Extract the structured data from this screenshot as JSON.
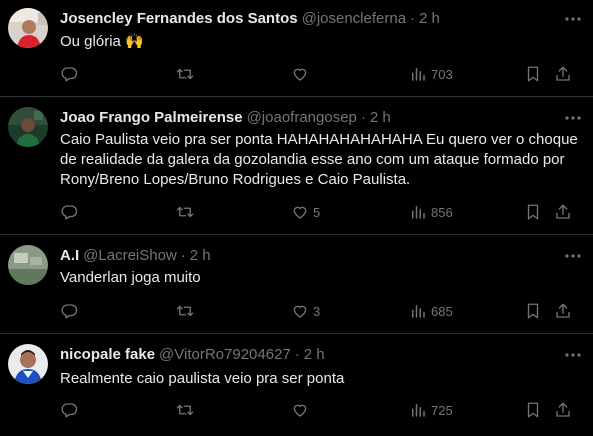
{
  "tweets": [
    {
      "display_name": "Josencley Fernandes dos Santos",
      "handle": "@josencleferna",
      "separator": "·",
      "time": "2 h",
      "text": "Ou glória 🙌",
      "replies": "",
      "retweets": "",
      "likes": "",
      "views": "703"
    },
    {
      "display_name": "Joao Frango Palmeirense",
      "handle": "@joaofrangosep",
      "separator": "·",
      "time": "2 h",
      "text": "Caio Paulista veio pra ser ponta HAHAHAHAHAHAHA Eu quero ver o choque de realidade da galera da gozolandia esse ano com um ataque formado por Rony/Breno Lopes/Bruno Rodrigues e Caio Paulista.",
      "replies": "",
      "retweets": "",
      "likes": "5",
      "views": "856"
    },
    {
      "display_name": "A.I",
      "handle": "@LacreiShow",
      "separator": "·",
      "time": "2 h",
      "text": "Vanderlan joga muito",
      "replies": "",
      "retweets": "",
      "likes": "3",
      "views": "685"
    },
    {
      "display_name": "nicopale fake",
      "handle": "@VitorRo79204627",
      "separator": "·",
      "time": "2 h",
      "text": "Realmente caio paulista veio pra ser ponta",
      "replies": "",
      "retweets": "",
      "likes": "",
      "views": "725"
    }
  ],
  "icons": {
    "reply": "reply-icon",
    "retweet": "retweet-icon",
    "like": "like-icon",
    "views": "views-icon",
    "bookmark": "bookmark-icon",
    "share": "share-icon",
    "more": "more-icon"
  },
  "colors": {
    "background": "#000000",
    "text_primary": "#e7e9ea",
    "text_secondary": "#71767b",
    "divider": "#2f3336"
  }
}
